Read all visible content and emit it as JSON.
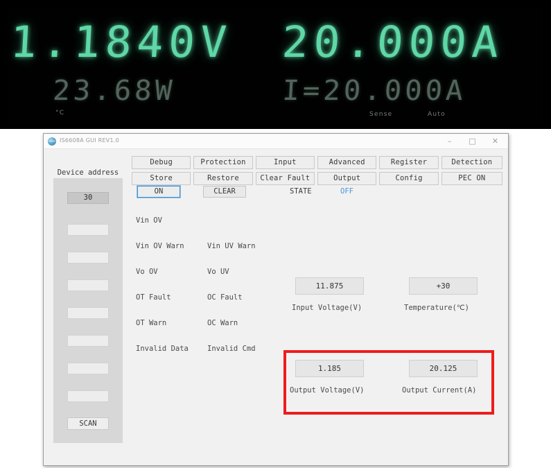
{
  "instrument_display": {
    "primary_voltage": "1.1840V",
    "primary_current": "20.000A",
    "secondary_power": "23.68W",
    "secondary_current_set": "I=20.000A",
    "label_degc": "°C",
    "label_sense": "Sense",
    "label_auto": "Auto",
    "segment_color": "#5fd7a7",
    "background_color": "#000000"
  },
  "window": {
    "title": "IS6608A GUI REV1.0",
    "icon": "globe-icon",
    "minimize_label": "–",
    "maximize_label": "□",
    "close_label": "✕"
  },
  "toolbar": {
    "row1": [
      "Debug",
      "Protection",
      "Input",
      "Advanced",
      "Register",
      "Detection"
    ],
    "row2": [
      "Store",
      "Restore",
      "Clear Fault",
      "Output",
      "Config",
      "PEC ON"
    ]
  },
  "sidebar": {
    "title": "Device address",
    "addresses": [
      "30",
      "",
      "",
      "",
      "",
      "",
      "",
      ""
    ],
    "selected_index": 0,
    "scan_label": "SCAN"
  },
  "controls": {
    "on_label": "ON",
    "clear_label": "CLEAR",
    "state_label": "STATE",
    "state_value": "OFF",
    "state_color": "#4a93df"
  },
  "status_flags": {
    "column_a": [
      "Vin OV",
      "Vin OV Warn",
      "Vo OV",
      "OT Fault",
      "OT Warn",
      "Invalid Data"
    ],
    "column_b": [
      "",
      "Vin UV Warn",
      "Vo UV",
      "OC Fault",
      "OC Warn",
      "Invalid Cmd"
    ]
  },
  "readouts": {
    "input_voltage": {
      "value": "11.875",
      "caption": "Input Voltage(V)"
    },
    "temperature": {
      "value": "+30",
      "caption": "Temperature(℃)"
    },
    "output_voltage": {
      "value": "1.185",
      "caption": "Output Voltage(V)"
    },
    "output_current": {
      "value": "20.125",
      "caption": "Output Current(A)"
    }
  },
  "annotation": {
    "highlight_color": "#ee1c1c",
    "highlight_target": "output-voltage-and-current-group"
  }
}
